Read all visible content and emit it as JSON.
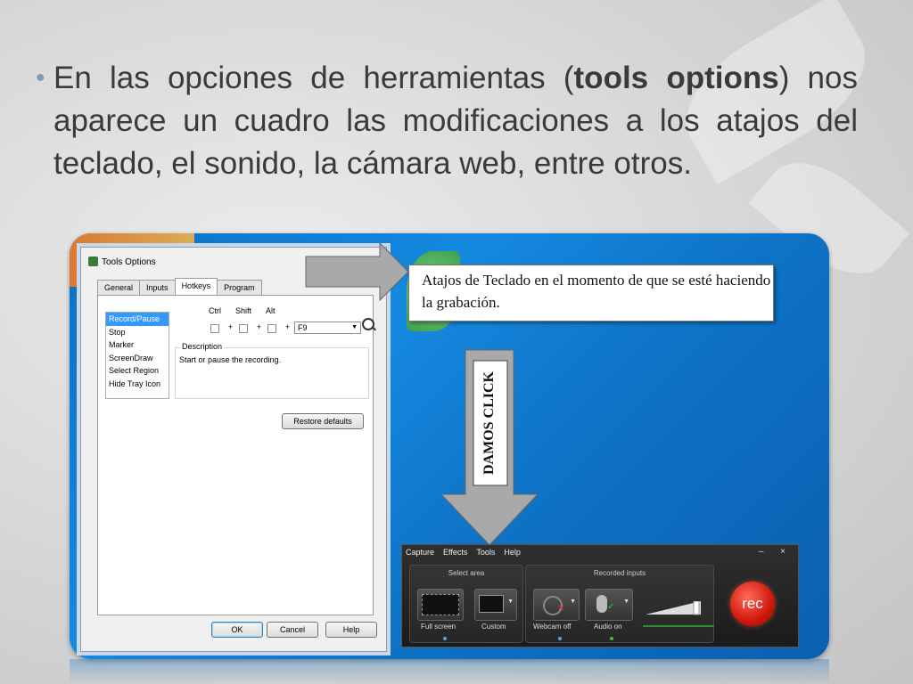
{
  "slide": {
    "bullet_part1": "En las opciones de herramientas (",
    "bullet_bold1": "tools options",
    "bullet_part2": ") nos aparece un cuadro las modificaciones a los atajos del teclado, el sonido, la cámara web, entre otros.",
    "bullet_color": "#7d9db8"
  },
  "dialog": {
    "title": "Tools Options",
    "tabs": [
      "General",
      "Inputs",
      "Hotkeys",
      "Program"
    ],
    "active_tab": "Hotkeys",
    "hotkey_items": [
      "Record/Pause",
      "Stop",
      "Marker",
      "ScreenDraw",
      "Select Region",
      "Hide Tray Icon"
    ],
    "selected_item": "Record/Pause",
    "modifiers": {
      "ctrl": "Ctrl",
      "shift": "Shift",
      "alt": "Alt"
    },
    "plus": "+",
    "key_value": "F9",
    "description_label": "Description",
    "description_text": "Start or pause the recording.",
    "restore_button": "Restore defaults",
    "ok_button": "OK",
    "cancel_button": "Cancel",
    "help_button": "Help"
  },
  "callout": {
    "text": "Atajos de Teclado en el momento de que se esté haciendo la grabación."
  },
  "arrow_label": "DAMOS CLICK",
  "toolbar": {
    "menu": [
      "Capture",
      "Effects",
      "Tools",
      "Help"
    ],
    "window_controls": "– ×",
    "select_area_title": "Select area",
    "recorded_inputs_title": "Recorded inputs",
    "full_screen_label": "Full screen",
    "custom_label": "Custom",
    "webcam_label": "Webcam off",
    "audio_label": "Audio on",
    "rec_label": "rec"
  }
}
